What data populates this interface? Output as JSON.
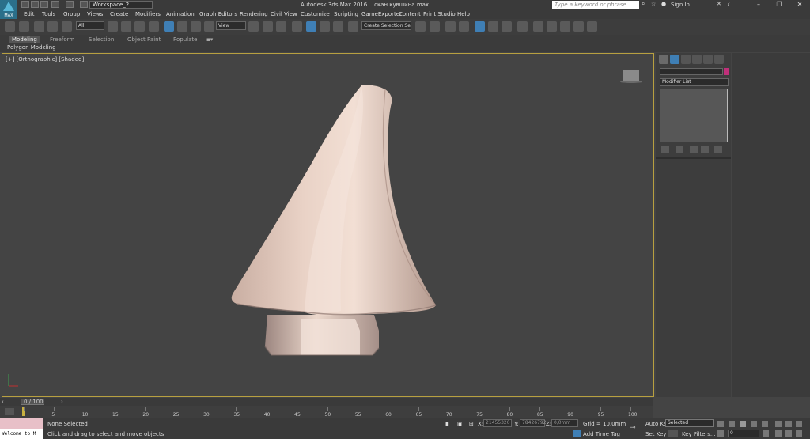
{
  "titlebar": {
    "logo_text": "MAX",
    "workspace": "Workspace_2",
    "app_title": "Autodesk 3ds Max 2016    скан кувшина.max",
    "search_placeholder": "Type a keyword or phrase",
    "sign_in": "Sign In"
  },
  "menu": [
    "Edit",
    "Tools",
    "Group",
    "Views",
    "Create",
    "Modifiers",
    "Animation",
    "Graph Editors",
    "Rendering",
    "Civil View",
    "Customize",
    "Scripting",
    "GameExporter",
    "Content",
    "Print Studio",
    "Help"
  ],
  "toolbar": {
    "filter_value": "All",
    "refcoord_value": "View",
    "selection_set_placeholder": "Create Selection Se"
  },
  "ribbon": {
    "tabs": [
      "Modeling",
      "Freeform",
      "Selection",
      "Object Paint",
      "Populate"
    ],
    "panel_label": "Polygon Modeling"
  },
  "viewport": {
    "label": "[+] [Orthographic] [Shaded]",
    "object_color": "#e6ccc0"
  },
  "command_panel": {
    "modifier_list": "Modifier List",
    "color_swatch": "#c0307a"
  },
  "timeline": {
    "frame_label": "0 / 100",
    "ticks": [
      0,
      5,
      10,
      15,
      20,
      25,
      30,
      35,
      40,
      45,
      50,
      55,
      60,
      65,
      70,
      75,
      80,
      85,
      90,
      95,
      100
    ]
  },
  "status": {
    "welcome": "Welcome to M",
    "selection": "None Selected",
    "hint": "Click and drag to select and move objects",
    "x_label": "X:",
    "x_value": "21455320",
    "y_label": "Y:",
    "y_value": "78426792",
    "z_label": "Z:",
    "z_value": "0,0mm",
    "grid": "Grid = 10,0mm",
    "add_time_tag": "Add Time Tag",
    "auto_key": "Auto Key",
    "set_key": "Set Key",
    "selected": "Selected",
    "key_filters": "Key Filters...",
    "frame": "0"
  }
}
